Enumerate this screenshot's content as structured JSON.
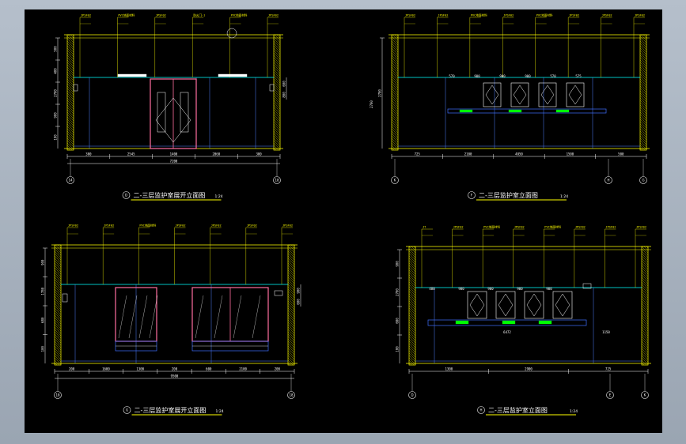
{
  "colors": {
    "background": "#000000",
    "wall": "#ffff00",
    "leader": "#ffff00",
    "dimension": "#ffffff",
    "ceiling": "#00ffff",
    "frame_lines": "#4f7fff",
    "door": "#ff6f9f",
    "furniture": "#ffffff",
    "lighting": "#00ff00",
    "glass_base": "#3f6fff"
  },
  "panels": [
    {
      "id": "A",
      "caption": "二-三层监护室展开立面图",
      "scale": "1:24",
      "marker": "D",
      "grid_labels": [
        "14",
        "18"
      ],
      "labels": [
        "JPSF02",
        "PVC地面材料",
        "JPSF02",
        "防火门-1",
        "PVC地面材料",
        "JPSF02"
      ],
      "dims_bottom": [
        "300",
        "2545",
        "1400",
        "2060",
        "300"
      ],
      "total": "7200",
      "dims_left": [
        "500",
        "400",
        "2700",
        "900",
        "100"
      ],
      "dims_right": [
        "600",
        "800"
      ]
    },
    {
      "id": "B",
      "caption": "二-三层监护室立面图",
      "scale": "1:24",
      "marker": "F",
      "grid_labels": [
        "K",
        "H",
        "G"
      ],
      "labels": [
        "JPSF02",
        "JPSF02",
        "PVC地面材料",
        "JPSF02",
        "PVC地面材料",
        "JPSF02",
        "JPSF02",
        "JPSF02"
      ],
      "dims_bottom": [
        "725",
        "2100",
        "4850",
        "1500",
        "500"
      ],
      "total": "",
      "dims_left": [
        "2700"
      ],
      "dims_right": [],
      "bay_dims": [
        "570",
        "900",
        "900",
        "900",
        "570",
        "575"
      ]
    },
    {
      "id": "C",
      "caption": "二-三层监护室展开立面图",
      "scale": "1:24",
      "marker": "G",
      "grid_labels": [
        "18",
        "18"
      ],
      "labels": [
        "JPSF02",
        "JPSF02",
        "PVC地面材料",
        "JPSF02",
        "JPSF02",
        "JPSF02",
        "JPSF02"
      ],
      "dims_bottom": [
        "200",
        "1600",
        "1300",
        "200",
        "600",
        "2100",
        "200"
      ],
      "total": "9500",
      "dims_left": [
        "900",
        "1780",
        "680",
        "100"
      ],
      "dims_right": [
        "900",
        "600"
      ]
    },
    {
      "id": "D",
      "caption": "二-三层监护室立面图",
      "scale": "1:24",
      "marker": "H",
      "grid_labels": [
        "D",
        "E",
        "K"
      ],
      "labels": [
        "JT",
        "JPSF02",
        "PVC地面材料",
        "JPSF02",
        "PVC地面材料",
        "JPSF02",
        "JPSF02",
        "JPSF02"
      ],
      "dims_bottom": [
        "1300",
        "2900",
        "725"
      ],
      "total": "",
      "dims_left": [
        "900",
        "2700",
        "680",
        "100"
      ],
      "dims_right": [],
      "bay_dims": [
        "480",
        "900",
        "900",
        "900",
        "900"
      ],
      "counter_dim": "6472",
      "side_dim": "1150"
    }
  ]
}
